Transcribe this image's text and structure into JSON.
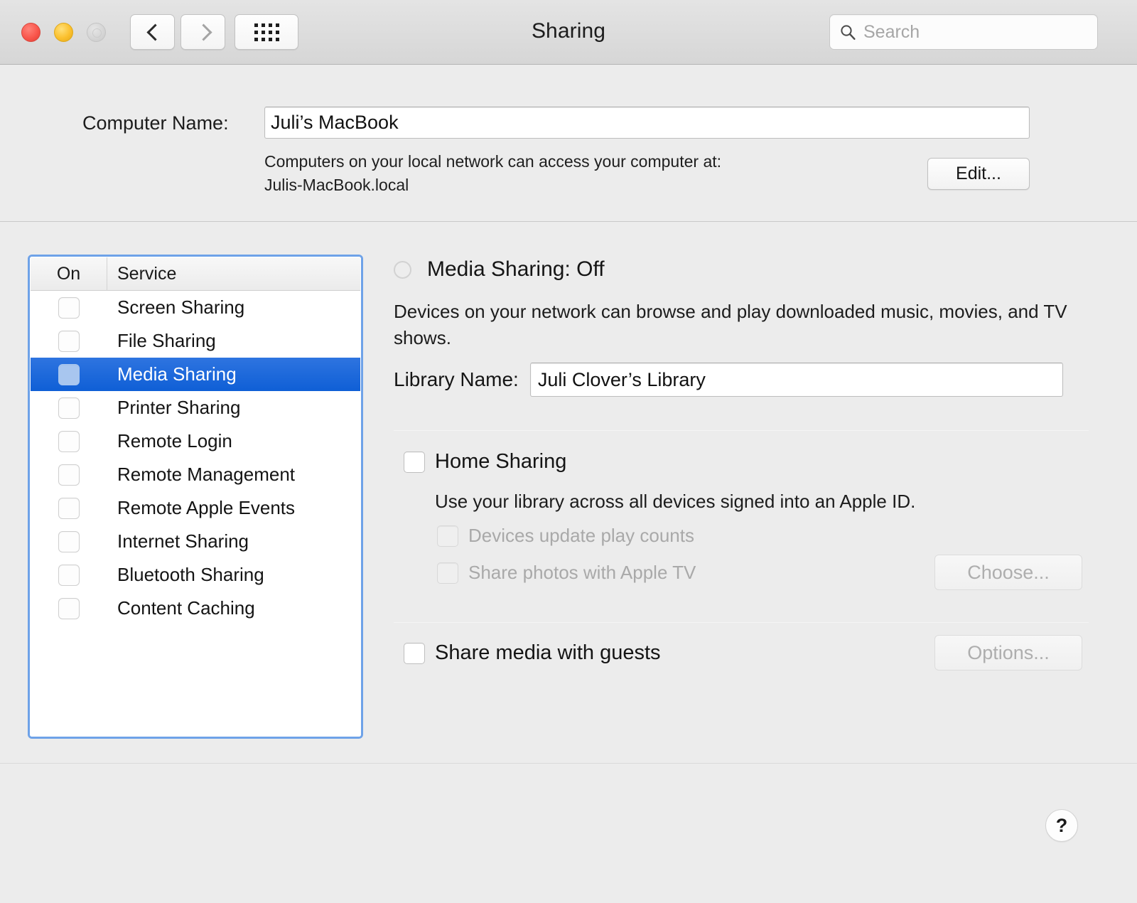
{
  "window": {
    "title": "Sharing",
    "traffic_lights": [
      "close",
      "minimize",
      "zoom-disabled"
    ]
  },
  "toolbar": {
    "back_icon": "chevron-left-icon",
    "forward_icon": "chevron-right-icon",
    "grid_icon": "show-all-grid-icon",
    "search": {
      "placeholder": "Search",
      "value": "",
      "icon": "search-icon"
    }
  },
  "computer_name_section": {
    "label": "Computer Name:",
    "value": "Juli’s MacBook",
    "help_line1": "Computers on your local network can access your computer at:",
    "help_line2": "Julis-MacBook.local",
    "edit_button": "Edit..."
  },
  "service_table": {
    "columns": [
      "On",
      "Service"
    ],
    "rows": [
      {
        "name": "Screen Sharing",
        "on": false,
        "selected": false
      },
      {
        "name": "File Sharing",
        "on": false,
        "selected": false
      },
      {
        "name": "Media Sharing",
        "on": false,
        "selected": true
      },
      {
        "name": "Printer Sharing",
        "on": false,
        "selected": false
      },
      {
        "name": "Remote Login",
        "on": false,
        "selected": false
      },
      {
        "name": "Remote Management",
        "on": false,
        "selected": false
      },
      {
        "name": "Remote Apple Events",
        "on": false,
        "selected": false
      },
      {
        "name": "Internet Sharing",
        "on": false,
        "selected": false
      },
      {
        "name": "Bluetooth Sharing",
        "on": false,
        "selected": false
      },
      {
        "name": "Content Caching",
        "on": false,
        "selected": false
      }
    ]
  },
  "detail_panel": {
    "status_indicator": "status-dot-off",
    "status_text": "Media Sharing: Off",
    "description": "Devices on your network can browse and play downloaded music, movies, and TV shows.",
    "library_name_label": "Library Name:",
    "library_name_value": "Juli Clover’s Library",
    "home_sharing": {
      "label": "Home Sharing",
      "checked": false,
      "description": "Use your library across all devices signed into an Apple ID.",
      "sub_options": [
        {
          "label": "Devices update play counts",
          "checked": false,
          "disabled": true
        },
        {
          "label": "Share photos with Apple TV",
          "checked": false,
          "disabled": true
        }
      ],
      "choose_button": {
        "label": "Choose...",
        "disabled": true
      }
    },
    "share_with_guests": {
      "label": "Share media with guests",
      "checked": false,
      "options_button": {
        "label": "Options...",
        "disabled": true
      }
    }
  },
  "footer": {
    "help_button": "?",
    "help_icon": "question-mark-icon"
  },
  "colors": {
    "selection_blue": "#1665d8",
    "focus_ring": "#6ea2e8",
    "window_bg": "#ececec",
    "traffic_close": "#f9564c",
    "traffic_min": "#fbc02d",
    "traffic_zoom": "#d6d6d6"
  }
}
